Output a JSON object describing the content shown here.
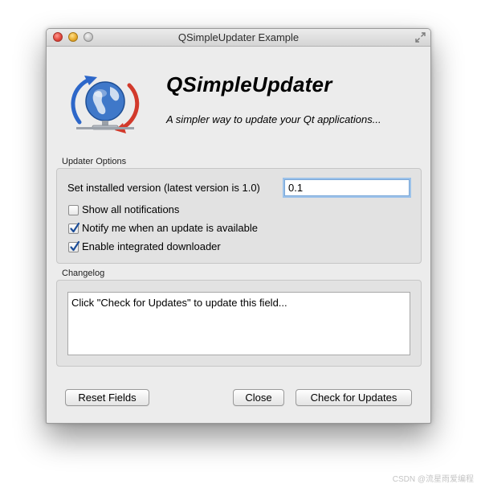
{
  "window": {
    "title": "QSimpleUpdater Example"
  },
  "header": {
    "app_name": "QSimpleUpdater",
    "tagline": "A simpler way to update your Qt applications...",
    "logo_icon": "globe-update-icon"
  },
  "updater_options": {
    "group_label": "Updater Options",
    "version_label": "Set installed version (latest version is 1.0)",
    "version_value": "0.1",
    "checkboxes": [
      {
        "label": "Show all notifications",
        "checked": false
      },
      {
        "label": "Notify me when an update is available",
        "checked": true
      },
      {
        "label": "Enable integrated downloader",
        "checked": true
      }
    ]
  },
  "changelog": {
    "group_label": "Changelog",
    "text": "Click \"Check for Updates\" to update this field..."
  },
  "buttons": {
    "reset": "Reset Fields",
    "close": "Close",
    "check": "Check for Updates"
  },
  "watermark": "CSDN @流星雨爱编程",
  "colors": {
    "accent": "#2d67c9",
    "window_bg": "#ececec",
    "focus_ring": "#9cc2ea"
  }
}
